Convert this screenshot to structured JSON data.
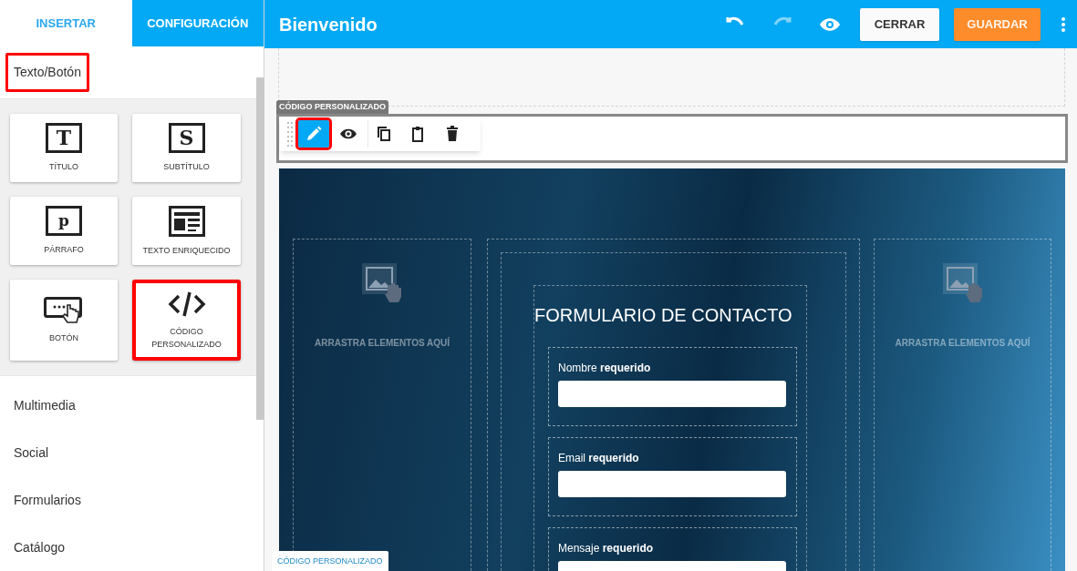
{
  "sidebar": {
    "tabs": [
      {
        "label": "INSERTAR",
        "selected": true
      },
      {
        "label": "CONFIGURACIÓN",
        "selected": false
      }
    ],
    "section": {
      "title": "Texto/Botón",
      "highlighted": true
    },
    "blocks": [
      {
        "kind": "title",
        "glyph": "T",
        "label": "TÍTULO",
        "highlighted": false
      },
      {
        "kind": "subtitle",
        "glyph": "S",
        "label": "SUBTÍTULO",
        "highlighted": false
      },
      {
        "kind": "paragraph",
        "glyph": "p",
        "label": "PÁRRAFO",
        "highlighted": false
      },
      {
        "kind": "richtext",
        "label": "TEXTO ENRIQUECIDO",
        "highlighted": false
      },
      {
        "kind": "button",
        "label": "BOTÓN",
        "highlighted": false
      },
      {
        "kind": "code",
        "label": "CÓDIGO PERSONALIZADO",
        "highlighted": true
      }
    ],
    "categories": [
      "Multimedia",
      "Social",
      "Formularios",
      "Catálogo"
    ]
  },
  "header": {
    "title": "Bienvenido",
    "tools": [
      {
        "kind": "undo",
        "disabled": false
      },
      {
        "kind": "redo",
        "disabled": true
      },
      {
        "kind": "preview",
        "disabled": false
      }
    ],
    "buttons": [
      {
        "label": "CERRAR",
        "kind": "secondary"
      },
      {
        "label": "GUARDAR",
        "kind": "primary"
      }
    ]
  },
  "canvas": {
    "block_tag": "CÓDIGO PERSONALIZADO",
    "block_toolbar": [
      {
        "kind": "edit",
        "highlighted": true
      },
      {
        "kind": "preview",
        "highlighted": false
      },
      {
        "kind": "duplicate",
        "highlighted": false
      },
      {
        "kind": "paste",
        "highlighted": false
      },
      {
        "kind": "delete",
        "highlighted": false
      }
    ],
    "drop_zones": [
      "ARRASTRA ELEMENTOS AQUÍ",
      "ARRASTRA ELEMENTOS AQUÍ"
    ],
    "form": {
      "title": "FORMULARIO DE CONTACTO",
      "fields": [
        {
          "label": "Nombre **requerido**"
        },
        {
          "label": "Email **requerido**"
        },
        {
          "label": "Mensaje **requerido**"
        }
      ]
    },
    "hover_tag": "CÓDIGO PERSONALIZADO"
  }
}
